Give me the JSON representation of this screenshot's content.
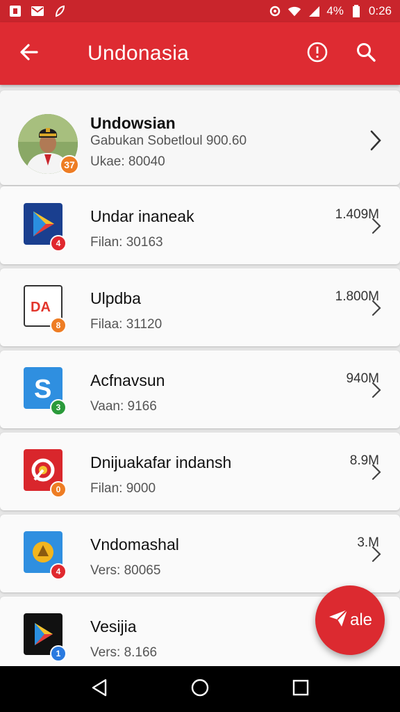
{
  "status_bar": {
    "battery_text": "4%",
    "time": "0:26",
    "left_icons": [
      "notification-square-icon",
      "mail-icon",
      "leaf-icon"
    ],
    "right_icons": [
      "alarm-icon",
      "wifi-icon",
      "signal-icon",
      "battery-icon"
    ]
  },
  "app_bar": {
    "title": "Undonasia",
    "back_icon": "arrow-left-icon",
    "actions": [
      "info-icon",
      "search-icon"
    ]
  },
  "profile": {
    "name": "Undowsian",
    "subtitle": "Gabukan Sobetloul 900.60",
    "meta": "Ukae: 80040",
    "badge": "37",
    "badge_color": "#ee7d24"
  },
  "apps": [
    {
      "name": "Undar inaneak",
      "meta": "Filan: 30163",
      "size": "1.409M",
      "icon": "play-triangle-icon",
      "icon_bg": "#1a3f8f",
      "badge": "4",
      "badge_color": "#e0282e"
    },
    {
      "name": "Ulpdba",
      "meta": "Filaa: 31120",
      "size": "1.800M",
      "icon": "da-logo-icon",
      "icon_bg": "#ffffff",
      "badge": "8",
      "badge_color": "#ee7d24"
    },
    {
      "name": "Acfnavsun",
      "meta": "Vaan: 9166",
      "size": "940M",
      "icon": "s-logo-icon",
      "icon_bg": "#2f8fe0",
      "badge": "3",
      "badge_color": "#2a9a3a"
    },
    {
      "name": "Dnijuakafar indansh",
      "meta": "Filan: 9000",
      "size": "8.9M",
      "icon": "swirl-logo-icon",
      "icon_bg": "#d9262c",
      "badge": "0",
      "badge_color": "#ee7d24"
    },
    {
      "name": "Vndomashal",
      "meta": "Vers: 80065",
      "size": "3.M",
      "icon": "emblem-logo-icon",
      "icon_bg": "#2f8fe0",
      "badge": "4",
      "badge_color": "#e0282e"
    },
    {
      "name": "Vesijia",
      "meta": "Vers: 8.166",
      "size": "",
      "icon": "play-color-icon",
      "icon_bg": "#111111",
      "badge": "1",
      "badge_color": "#2a7ae0"
    }
  ],
  "fab": {
    "label": "ale",
    "icon": "send-plane-icon"
  },
  "nav": [
    "back-triangle-icon",
    "home-circle-icon",
    "recents-square-icon"
  ],
  "colors": {
    "primary": "#de2b32",
    "status_bar": "#c9252c"
  }
}
